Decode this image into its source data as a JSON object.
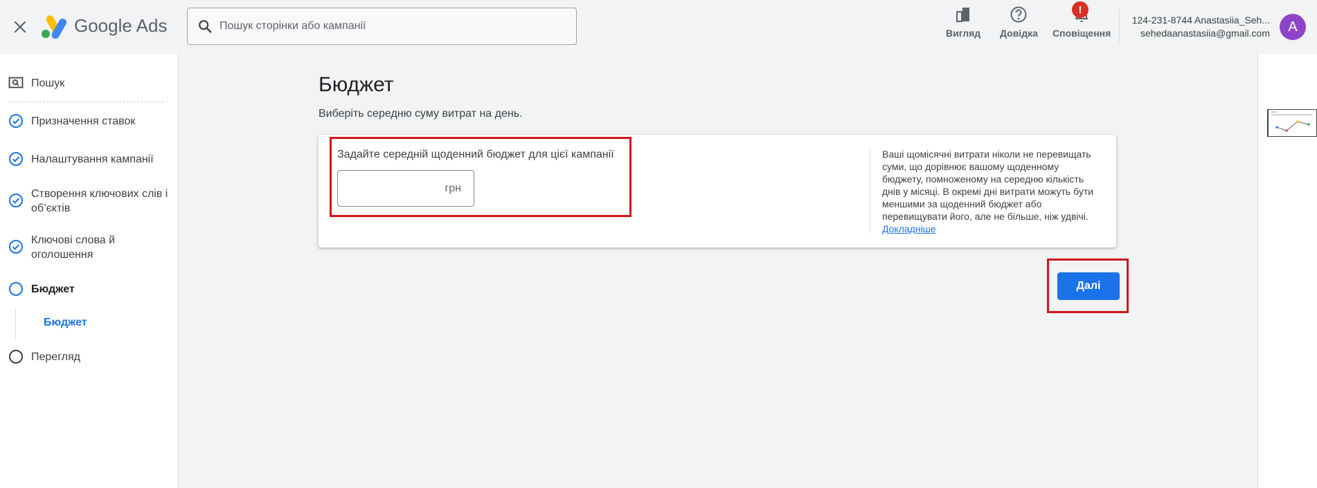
{
  "header": {
    "brand": {
      "google": "Google",
      "ads": "Ads"
    },
    "search_placeholder": "Пошук сторінки або кампанії",
    "buttons": [
      {
        "label": "Вигляд",
        "icon": "view-icon"
      },
      {
        "label": "Довідка",
        "icon": "help-icon"
      },
      {
        "label": "Сповіщення",
        "icon": "bell-icon",
        "badge": "!"
      }
    ],
    "account": {
      "line1": "124-231-8744 Anastasiia_Seh...",
      "line2": "sehedaanastasiia@gmail.com",
      "avatar_letter": "A"
    }
  },
  "sidebar": {
    "items": [
      {
        "label": "Пошук",
        "icon": "search-campaign-icon",
        "state": "type"
      },
      {
        "label": "Призначення ставок",
        "icon": "check-circle-icon",
        "state": "done"
      },
      {
        "label": "Налаштування кампанії",
        "icon": "check-circle-icon",
        "state": "done"
      },
      {
        "label": "Створення ключових слів і об’єктів",
        "icon": "check-circle-icon",
        "state": "done"
      },
      {
        "label": "Ключові слова й оголошення",
        "icon": "check-circle-icon",
        "state": "done"
      },
      {
        "label": "Бюджет",
        "icon": "circle-active-icon",
        "state": "active"
      },
      {
        "label": "Перегляд",
        "icon": "circle-icon",
        "state": "todo"
      }
    ],
    "sub_item": "Бюджет"
  },
  "main": {
    "title": "Бюджет",
    "subtitle": "Виберіть середню суму витрат на день.",
    "card": {
      "label": "Задайте середній щоденний бюджет для цієї кампанії",
      "input_value": "",
      "currency": "грн",
      "help_text": "Ваші щомісячні витрати ніколи не перевищать суми, що дорівнює вашому щоденному бюджету, помноженому на середню кількість днів у місяці. В окремі дні витрати можуть бути меншими за щоденний бюджет або перевищувати його, але не більше, ніж удвічі.",
      "learn_more": "Докладніше"
    },
    "next_label": "Далі"
  },
  "colors": {
    "accent": "#1a73e8",
    "highlight": "#d0151b",
    "badge": "#d93025",
    "avatar": "#8e44c8"
  }
}
